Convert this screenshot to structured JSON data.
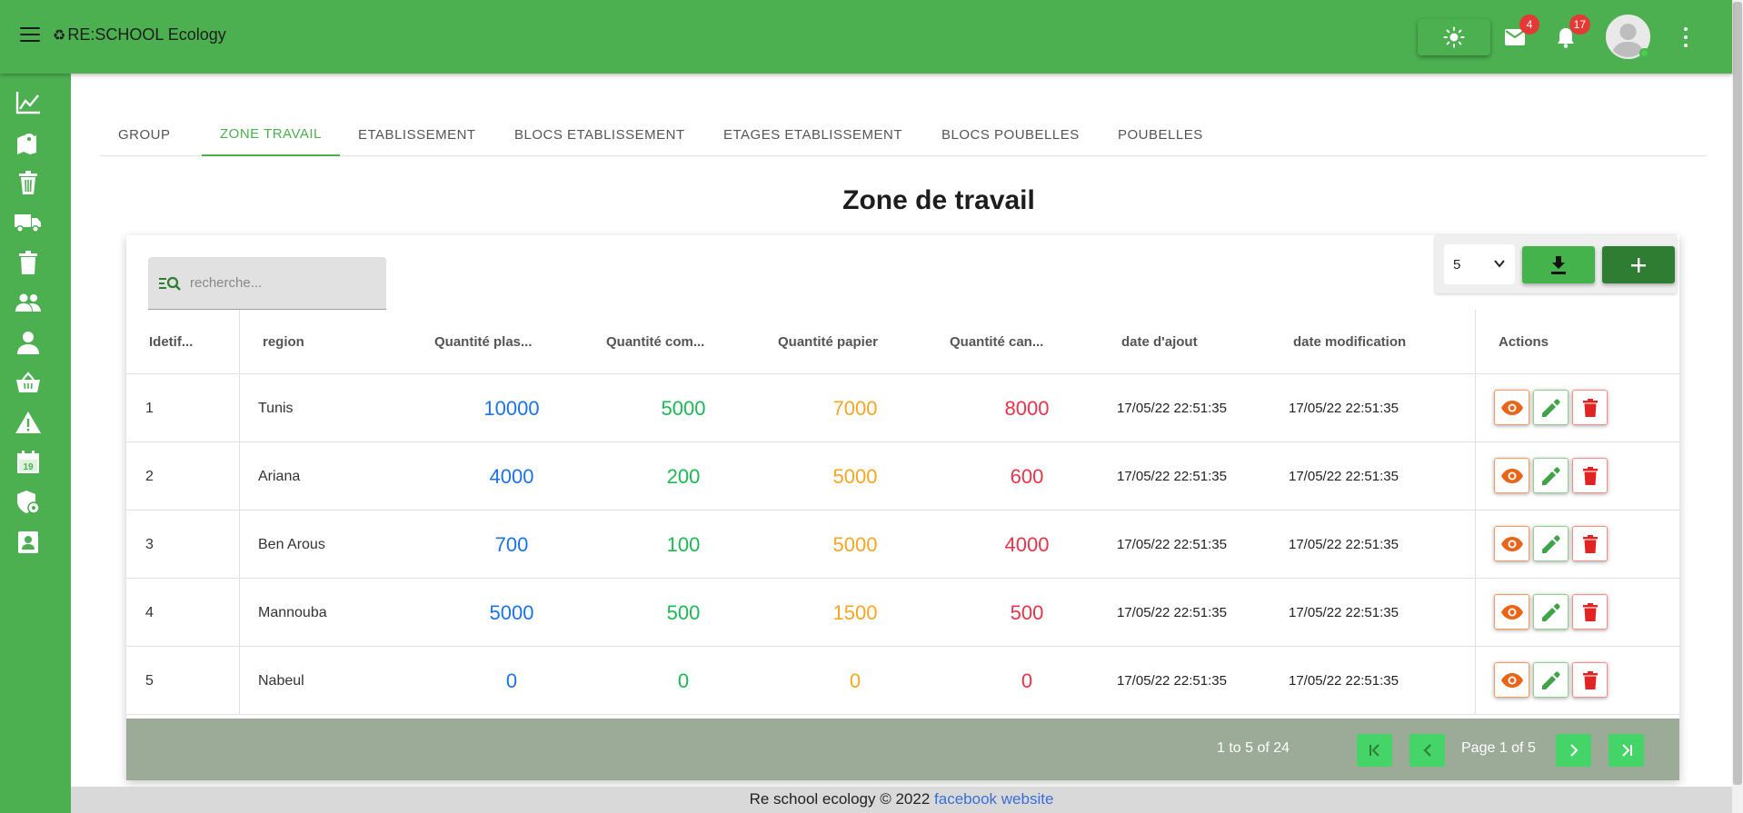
{
  "app": {
    "brand": "RE:SCHOOL Ecology",
    "mail_count": "4",
    "notif_count": "17"
  },
  "sidebar": {
    "items": [
      {
        "icon": "chart-line-icon"
      },
      {
        "icon": "map-marker-icon"
      },
      {
        "icon": "trash-bin-icon"
      },
      {
        "icon": "truck-icon"
      },
      {
        "icon": "delete-icon"
      },
      {
        "icon": "group-icon"
      },
      {
        "icon": "person-icon"
      },
      {
        "icon": "basket-icon"
      },
      {
        "icon": "warning-icon"
      },
      {
        "icon": "calendar-icon"
      },
      {
        "icon": "admin-shield-icon"
      },
      {
        "icon": "contact-card-icon"
      }
    ],
    "calendar_day": "19"
  },
  "tabs": [
    "GROUP",
    "ZONE TRAVAIL",
    "ETABLISSEMENT",
    "BLOCS ETABLISSEMENT",
    "ETAGES ETABLISSEMENT",
    "BLOCS POUBELLES",
    "POUBELLES"
  ],
  "page_title": "Zone de travail",
  "search": {
    "placeholder": "recherche..."
  },
  "toolbar": {
    "page_size": "5"
  },
  "table": {
    "headers": [
      "Idetif...",
      "region",
      "Quantité plas...",
      "Quantité com...",
      "Quantité papier",
      "Quantité can...",
      "date d'ajout",
      "date modification",
      "Actions"
    ],
    "rows": [
      {
        "id": "1",
        "region": "Tunis",
        "plastique": "10000",
        "composte": "5000",
        "papier": "7000",
        "canette": "8000",
        "date_ajout": "17/05/22 22:51:35",
        "date_modif": "17/05/22 22:51:35"
      },
      {
        "id": "2",
        "region": "Ariana",
        "plastique": "4000",
        "composte": "200",
        "papier": "5000",
        "canette": "600",
        "date_ajout": "17/05/22 22:51:35",
        "date_modif": "17/05/22 22:51:35"
      },
      {
        "id": "3",
        "region": "Ben Arous",
        "plastique": "700",
        "composte": "100",
        "papier": "5000",
        "canette": "4000",
        "date_ajout": "17/05/22 22:51:35",
        "date_modif": "17/05/22 22:51:35"
      },
      {
        "id": "4",
        "region": "Mannouba",
        "plastique": "5000",
        "composte": "500",
        "papier": "1500",
        "canette": "500",
        "date_ajout": "17/05/22 22:51:35",
        "date_modif": "17/05/22 22:51:35"
      },
      {
        "id": "5",
        "region": "Nabeul",
        "plastique": "0",
        "composte": "0",
        "papier": "0",
        "canette": "0",
        "date_ajout": "17/05/22 22:51:35",
        "date_modif": "17/05/22 22:51:35"
      }
    ]
  },
  "pager": {
    "range": "1 to 5 of 24",
    "page": "Page 1 of 5"
  },
  "footer": {
    "text": "Re school ecology © 2022",
    "link1": "facebook",
    "link2": "website"
  },
  "colors": {
    "green": "#4caf50",
    "plastique": "#1a73e8",
    "composte": "#1db954",
    "papier": "#f5a623",
    "canette": "#e8334a"
  }
}
